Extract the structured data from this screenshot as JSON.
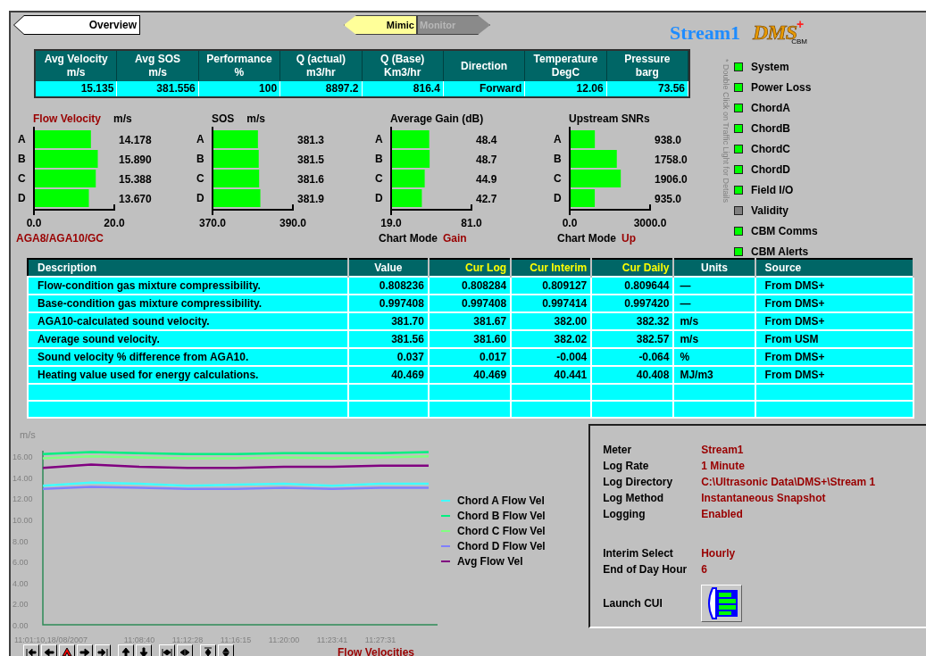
{
  "back_button": {
    "label": "Overview"
  },
  "view_tabs": [
    {
      "label": "Mimic",
      "selected": true
    },
    {
      "label": "Monitor",
      "selected": false
    }
  ],
  "header": {
    "title": "Stream1",
    "logo": {
      "text": "DMS",
      "mark": "+",
      "subtext": "CBM"
    }
  },
  "summary": {
    "columns": [
      {
        "title": "Avg Velocity",
        "unit": "m/s",
        "value": "15.135"
      },
      {
        "title": "Avg SOS",
        "unit": "m/s",
        "value": "381.556"
      },
      {
        "title": "Performance",
        "unit": "%",
        "value": "100"
      },
      {
        "title": "Q (actual)",
        "unit": "m3/hr",
        "value": "8897.2"
      },
      {
        "title": "Q (Base)",
        "unit": "Km3/hr",
        "value": "816.4"
      },
      {
        "title": "Direction",
        "value": "Forward"
      },
      {
        "title": "Temperature",
        "unit": "DegC",
        "value": "12.06"
      },
      {
        "title": "Pressure",
        "unit": "barg",
        "value": "73.56"
      }
    ]
  },
  "bar_charts": [
    {
      "title": "Flow Velocity",
      "unit": "m/s",
      "highlighted": true,
      "footnote": "AGA8/AGA10/GC",
      "readings": [
        "14.178",
        "15.890",
        "15.388",
        "13.670"
      ],
      "chart_data": {
        "type": "bar",
        "orientation": "horizontal",
        "categories": [
          "A",
          "B",
          "C",
          "D"
        ],
        "values": [
          14.178,
          15.89,
          15.388,
          13.67
        ],
        "xlim": [
          0,
          20
        ],
        "xticks": [
          {
            "value": 0,
            "label": "0.0"
          },
          {
            "value": 20,
            "label": "20.0"
          }
        ]
      }
    },
    {
      "title": "SOS",
      "unit": "m/s",
      "highlighted": false,
      "readings": [
        "381.3",
        "381.5",
        "381.6",
        "381.9"
      ],
      "chart_data": {
        "type": "bar",
        "orientation": "horizontal",
        "categories": [
          "A",
          "B",
          "C",
          "D"
        ],
        "values": [
          381.3,
          381.5,
          381.6,
          381.9
        ],
        "xlim": [
          370,
          390
        ],
        "xticks": [
          {
            "value": 370,
            "label": "370.0"
          },
          {
            "value": 390,
            "label": "390.0"
          }
        ]
      }
    },
    {
      "title": "Average Gain (dB)",
      "highlighted": false,
      "mode": {
        "label": "Chart Mode",
        "value": "Gain"
      },
      "readings": [
        "48.4",
        "48.7",
        "44.9",
        "42.7"
      ],
      "chart_data": {
        "type": "bar",
        "orientation": "horizontal",
        "categories": [
          "A",
          "B",
          "C",
          "D"
        ],
        "values": [
          48.4,
          48.7,
          44.9,
          42.7
        ],
        "xlim": [
          19,
          81
        ],
        "xticks": [
          {
            "value": 19,
            "label": "19.0"
          },
          {
            "value": 81,
            "label": "81.0"
          }
        ]
      }
    },
    {
      "title": "Upstream SNRs",
      "highlighted": false,
      "mode": {
        "label": "Chart Mode",
        "value": "Up"
      },
      "readings": [
        "938.0",
        "1758.0",
        "1906.0",
        "935.0"
      ],
      "chart_data": {
        "type": "bar",
        "orientation": "horizontal",
        "categories": [
          "A",
          "B",
          "C",
          "D"
        ],
        "values": [
          938,
          1758,
          1906,
          935
        ],
        "xlim": [
          0,
          3000
        ],
        "xticks": [
          {
            "value": 0,
            "label": "0.0"
          },
          {
            "value": 3000,
            "label": "3000.0"
          }
        ]
      }
    }
  ],
  "status_hint": "* Double Click on Traffic Light for Details",
  "status_lights": [
    {
      "label": "System",
      "color": "#00ff00"
    },
    {
      "label": "Power Loss",
      "color": "#00ff00"
    },
    {
      "label": "ChordA",
      "color": "#00ff00"
    },
    {
      "label": "ChordB",
      "color": "#00ff00"
    },
    {
      "label": "ChordC",
      "color": "#00ff00"
    },
    {
      "label": "ChordD",
      "color": "#00ff00"
    },
    {
      "label": "Field I/O",
      "color": "#00ff00"
    },
    {
      "label": "Validity",
      "color": "#808080"
    },
    {
      "label": "CBM Comms",
      "color": "#00ff00"
    },
    {
      "label": "CBM Alerts",
      "color": "#00ff00"
    }
  ],
  "data_table": {
    "columns": [
      {
        "label": "Description",
        "kind": "text",
        "highlighted": false
      },
      {
        "label": "Value",
        "kind": "number",
        "highlighted": false
      },
      {
        "label": "Cur Log",
        "kind": "number",
        "highlighted": true
      },
      {
        "label": "Cur Interim",
        "kind": "number",
        "highlighted": true
      },
      {
        "label": "Cur Daily",
        "kind": "number",
        "highlighted": true
      },
      {
        "label": "Units",
        "kind": "unit",
        "highlighted": false
      },
      {
        "label": "Source",
        "kind": "text",
        "highlighted": false
      }
    ],
    "rows": [
      [
        "Flow-condition gas mixture compressibility.",
        "0.808236",
        "0.808284",
        "0.809127",
        "0.809644",
        "—",
        "From DMS+"
      ],
      [
        "Base-condition gas mixture compressibility.",
        "0.997408",
        "0.997408",
        "0.997414",
        "0.997420",
        "—",
        "From DMS+"
      ],
      [
        "AGA10-calculated sound velocity.",
        "381.70",
        "381.67",
        "382.00",
        "382.32",
        "m/s",
        "From DMS+"
      ],
      [
        "Average sound velocity.",
        "381.56",
        "381.60",
        "382.02",
        "382.57",
        "m/s",
        "From USM"
      ],
      [
        "Sound velocity % difference from AGA10.",
        "0.037",
        "0.017",
        "-0.004",
        "-0.064",
        "%",
        "From DMS+"
      ],
      [
        "Heating value used for energy calculations.",
        "40.469",
        "40.469",
        "40.441",
        "40.408",
        "MJ/m3",
        "From DMS+"
      ]
    ]
  },
  "trend": {
    "title": "Flow Velocities",
    "chart_data": {
      "type": "line",
      "ylabel": "m/s",
      "categories": [
        "11:01:10,18/08/2007",
        null,
        "11:08:40",
        "11:12:28",
        "11:16:15",
        "11:20:00",
        "11:23:41",
        "11:27:31",
        null
      ],
      "ylim": [
        0,
        17
      ],
      "legend": true,
      "yticks": [
        {
          "value": 0,
          "label": "0.00"
        },
        {
          "value": 2,
          "label": "2.00"
        },
        {
          "value": 4,
          "label": "4.00"
        },
        {
          "value": 6,
          "label": "6.00"
        },
        {
          "value": 8,
          "label": "8.00"
        },
        {
          "value": 10,
          "label": "10.00"
        },
        {
          "value": 12,
          "label": "12.00"
        },
        {
          "value": 14,
          "label": "14.00"
        },
        {
          "value": 16,
          "label": "16.00"
        }
      ],
      "series": [
        {
          "name": "Chord A Flow Vel",
          "color": "#40ffff",
          "values": [
            13.2,
            13.5,
            13.4,
            13.2,
            13.3,
            13.4,
            13.2,
            13.4,
            13.4
          ]
        },
        {
          "name": "Chord B Flow Vel",
          "color": "#00f080",
          "values": [
            16.2,
            16.4,
            16.3,
            16.2,
            16.2,
            16.3,
            16.3,
            16.3,
            16.4
          ]
        },
        {
          "name": "Chord C Flow Vel",
          "color": "#80ff80",
          "values": [
            15.8,
            16.0,
            15.9,
            15.8,
            15.8,
            15.9,
            15.8,
            15.9,
            16.0
          ]
        },
        {
          "name": "Chord D Flow Vel",
          "color": "#8080ff",
          "values": [
            12.9,
            13.1,
            13.0,
            12.9,
            12.9,
            13.0,
            12.9,
            13.0,
            13.0
          ]
        },
        {
          "name": "Avg Flow Vel",
          "color": "#800080",
          "values": [
            14.9,
            15.2,
            15.0,
            14.9,
            14.9,
            15.0,
            15.0,
            15.1,
            15.1
          ]
        }
      ]
    }
  },
  "info_panel": {
    "groups": [
      [
        {
          "label": "Meter",
          "value": "Stream1"
        },
        {
          "label": "Log Rate",
          "value": "1 Minute"
        },
        {
          "label": "Log Directory",
          "value": "C:\\Ultrasonic Data\\DMS+\\Stream 1"
        },
        {
          "label": "Log Method",
          "value": "Instantaneous Snapshot"
        },
        {
          "label": "Logging",
          "value": "Enabled"
        }
      ],
      [
        {
          "label": "Interim Select",
          "value": "Hourly"
        },
        {
          "label": "End of Day Hour",
          "value": "6"
        }
      ]
    ],
    "launch": {
      "label": "Launch CUI"
    }
  }
}
